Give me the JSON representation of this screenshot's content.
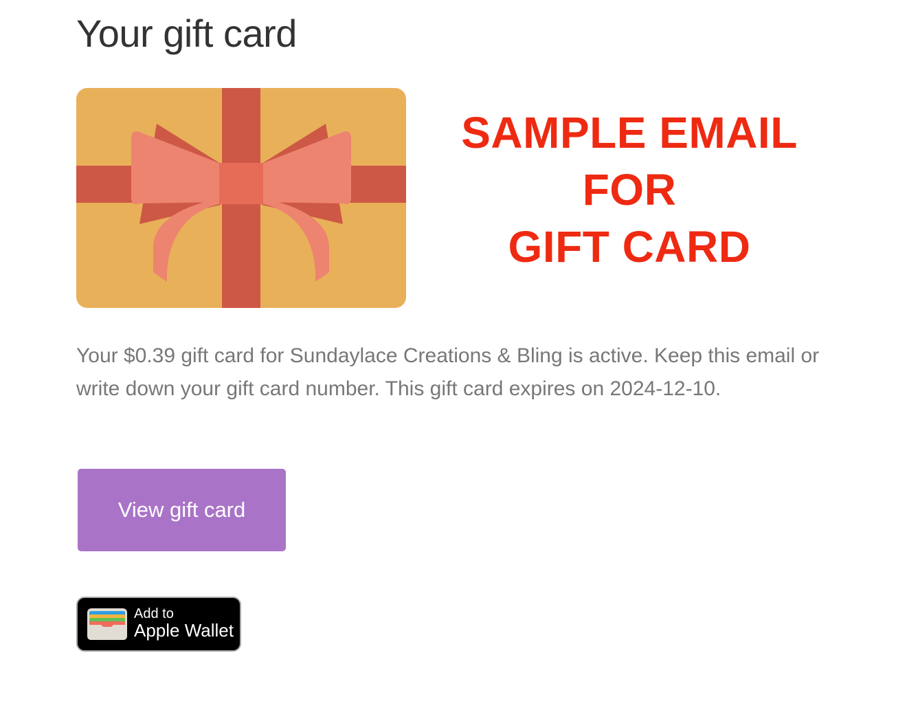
{
  "header": {
    "title": "Your gift card"
  },
  "gift_card_image": {
    "icon": "gift-ribbon-card",
    "colors": {
      "card": "#e9b05a",
      "ribbon": "#cd5845",
      "bow": "#ec8470",
      "knot": "#e76c58"
    }
  },
  "sample_banner": {
    "line1": "SAMPLE EMAIL",
    "line2": "FOR",
    "line3": "GIFT CARD",
    "color": "#ee2a12"
  },
  "message": {
    "text": "Your $0.39 gift card for Sundaylace Creations & Bling is active. Keep this email or write down your gift card number. This gift card expires on 2024-12-10."
  },
  "view_button": {
    "label": "View gift card",
    "color": "#a974c7"
  },
  "wallet_button": {
    "small_label": "Add to",
    "large_label": "Apple Wallet",
    "icon": "wallet-icon"
  }
}
